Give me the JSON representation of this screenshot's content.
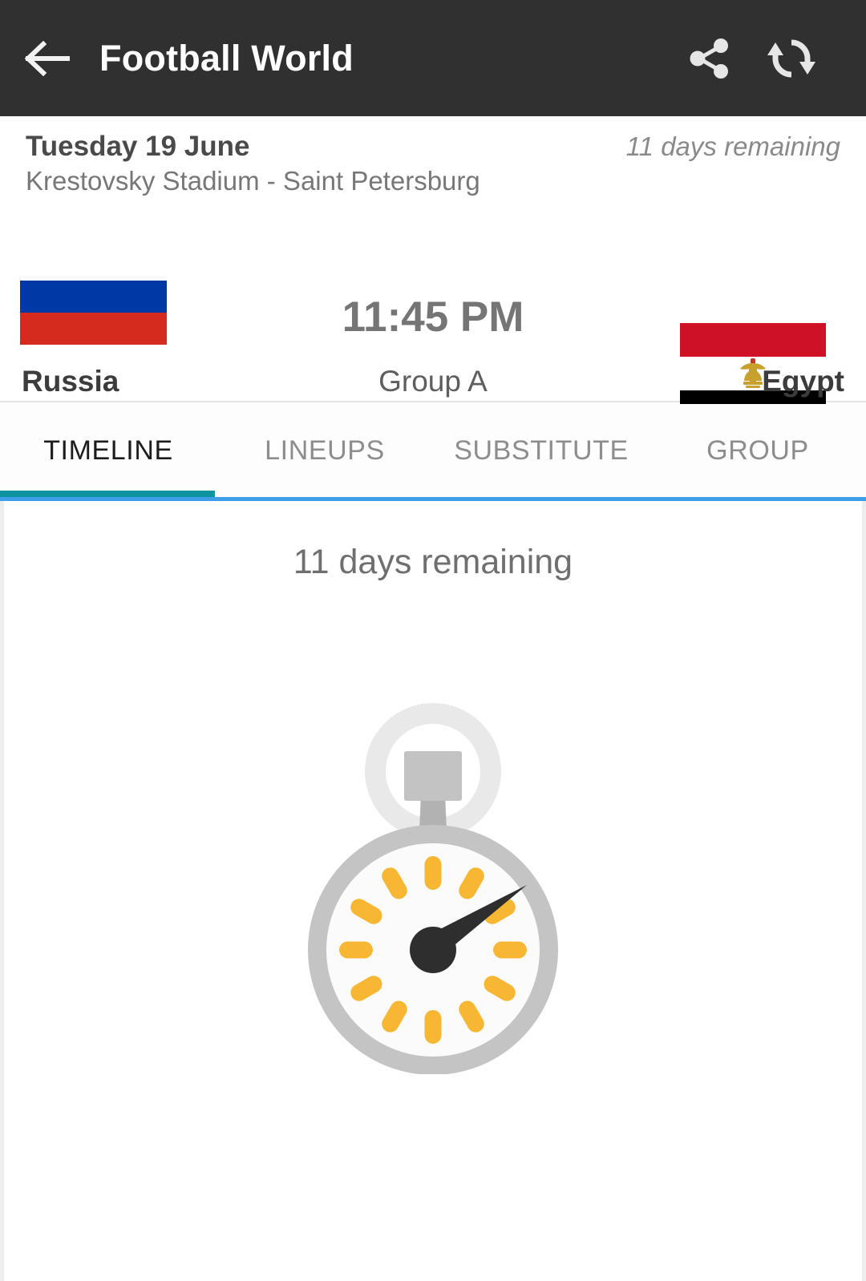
{
  "appbar": {
    "title": "Football World",
    "back_icon": "arrow-left-icon",
    "share_icon": "share-icon",
    "refresh_icon": "refresh-icon",
    "background": "#303030"
  },
  "match": {
    "date": "Tuesday 19 June",
    "countdown": "11 days remaining",
    "venue": "Krestovsky Stadium - Saint Petersburg",
    "kickoff_time": "11:45 PM",
    "group": "Group A",
    "home": {
      "name": "Russia",
      "flag_icon": "flag-russia",
      "flag_bands": [
        "#ffffff",
        "#0039a6",
        "#d52b1e"
      ]
    },
    "away": {
      "name": "Egypt",
      "flag_icon": "flag-egypt",
      "flag_bands": [
        "#ce1126",
        "#ffffff",
        "#000000"
      ],
      "emblem_color": "#c8a02e"
    }
  },
  "tabs": {
    "items": [
      {
        "label": "TIMELINE",
        "active": true
      },
      {
        "label": "LINEUPS",
        "active": false
      },
      {
        "label": "SUBSTITUTE",
        "active": false
      },
      {
        "label": "GROUP",
        "active": false
      }
    ],
    "indicator_color": "#0e94a0",
    "underline_color": "#3f9ee8"
  },
  "content": {
    "message": "11 days remaining",
    "illustration": "stopwatch-icon",
    "stopwatch_colors": {
      "ring": "#e8e8e8",
      "bezel": "#bdbdbd",
      "crown": "#b9b9b9",
      "face": "#ffffff",
      "ticks": "#f7b733",
      "hand": "#2e2e2e"
    }
  }
}
